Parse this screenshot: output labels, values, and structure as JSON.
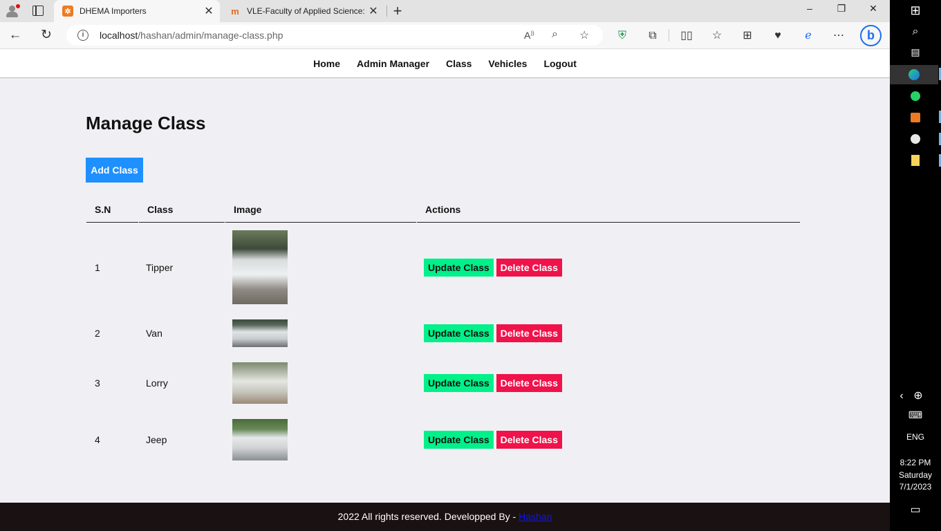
{
  "browser": {
    "tabs": [
      {
        "label": "DHEMA Importers",
        "favicon": "xampp-icon",
        "active": true
      },
      {
        "label": "VLE-Faculty of Applied Science: L",
        "favicon": "moodle-icon",
        "active": false
      }
    ],
    "close_glyph": "✕",
    "new_tab_glyph": "+",
    "url_path": "localhost/hashan/admin/manage-class.php",
    "url_host": "localhost",
    "url_rest": "/hashan/admin/manage-class.php",
    "window_controls": [
      "–",
      "❐",
      "✕"
    ]
  },
  "nav": {
    "items": [
      "Home",
      "Admin Manager",
      "Class",
      "Vehicles",
      "Logout"
    ]
  },
  "page": {
    "title": "Manage Class",
    "add_button": "Add Class"
  },
  "table": {
    "headers": [
      "S.N",
      "Class",
      "Image",
      "Actions"
    ],
    "rows": [
      {
        "sn": "1",
        "class": "Tipper",
        "image": "tipper-truck-photo"
      },
      {
        "sn": "2",
        "class": "Van",
        "image": "van-photo"
      },
      {
        "sn": "3",
        "class": "Lorry",
        "image": "lorry-photo"
      },
      {
        "sn": "4",
        "class": "Jeep",
        "image": "jeep-photo"
      }
    ],
    "update_label": "Update Class",
    "delete_label": "Delete Class"
  },
  "footer": {
    "text": "2022 All rights reserved. Developped By - ",
    "link": "Hashan"
  },
  "taskbar": {
    "language": "ENG",
    "time": "8:22 PM",
    "day": "Saturday",
    "date": "7/1/2023"
  },
  "colors": {
    "add_button": "#1e90ff",
    "update_button": "#00f08a",
    "delete_button": "#f0124a",
    "footer_bg": "#1a1212"
  }
}
